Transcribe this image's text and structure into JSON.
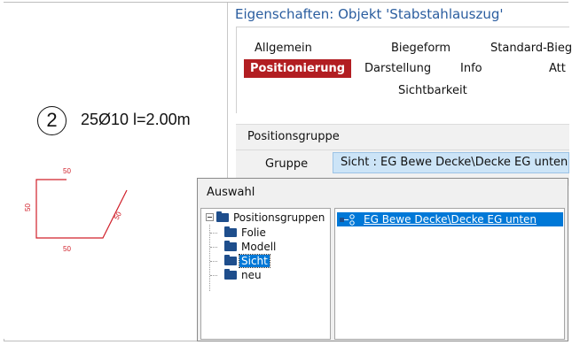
{
  "cad": {
    "position_number": "2",
    "position_text": "25Ø10 l=2.00m",
    "dims": {
      "top": "50",
      "left": "50",
      "bottom": "50",
      "diag": "50"
    }
  },
  "properties": {
    "title": "Eigenschaften: Objekt 'Stabstahlauszug'",
    "tabs": {
      "allgemein": "Allgemein",
      "biegeform": "Biegeform",
      "standard": "Standard-Bieg",
      "positionierung": "Positionierung",
      "darstellung": "Darstellung",
      "info": "Info",
      "att": "Att",
      "sichtbarkeit": "Sichtbarkeit"
    },
    "section": "Positionsgruppe",
    "group_label": "Gruppe",
    "group_value": "Sicht : EG Bewe Decke\\Decke EG unten"
  },
  "auswahl": {
    "title": "Auswahl",
    "tree": {
      "root": "Positionsgruppen",
      "children": [
        "Folie",
        "Modell",
        "Sicht",
        "neu"
      ],
      "selected": "Sicht"
    },
    "list": {
      "items": [
        "EG Bewe Decke\\Decke EG unten"
      ]
    }
  },
  "colors": {
    "accent": "#b21e22",
    "title_blue": "#2a5d9f",
    "selection": "#0078d7",
    "cad_red": "#d0202a"
  }
}
